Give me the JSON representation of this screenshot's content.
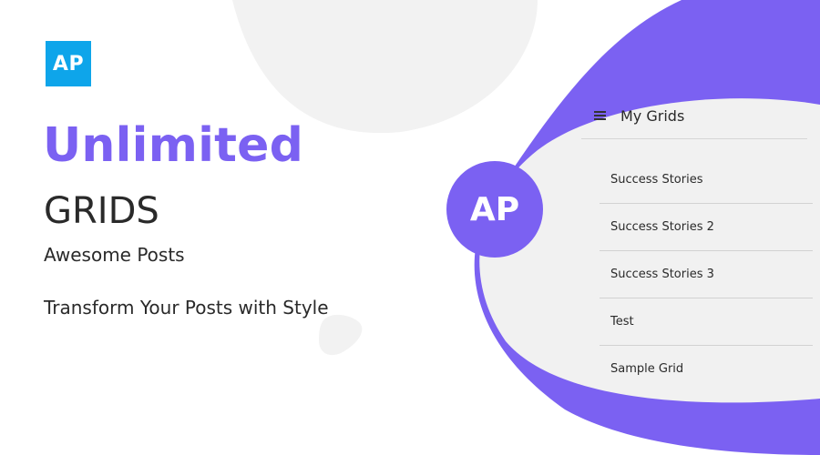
{
  "logo": {
    "text": "AP"
  },
  "hero": {
    "headline": "Unlimited",
    "subheadline": "GRIDS",
    "brand": "Awesome Posts",
    "tagline": "Transform Your Posts with Style"
  },
  "avatar": {
    "text": "AP"
  },
  "panel": {
    "title": "My Grids",
    "items": [
      {
        "label": "Success Stories"
      },
      {
        "label": "Success Stories 2"
      },
      {
        "label": "Success Stories 3"
      },
      {
        "label": "Test"
      },
      {
        "label": "Sample Grid"
      }
    ]
  },
  "colors": {
    "accent": "#7b61f2",
    "logo_bg": "#0ea5ea",
    "panel_bg": "#f1f1f1",
    "decor_gray": "#f2f2f2"
  },
  "icons": {
    "menu": "hamburger-menu-icon"
  }
}
